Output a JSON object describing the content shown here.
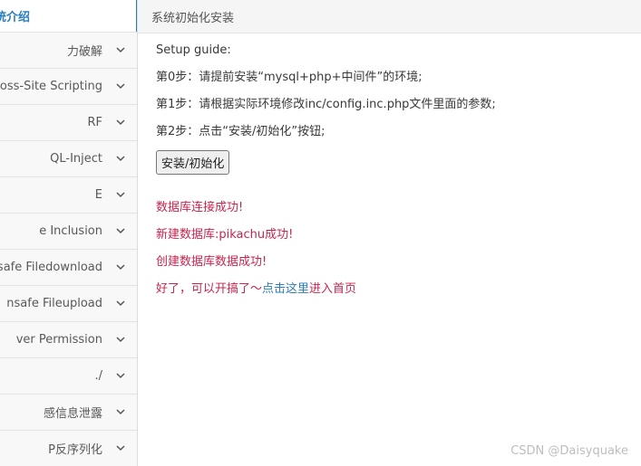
{
  "sidebar": {
    "items": [
      {
        "label": "统介绍",
        "active": true
      },
      {
        "label": "力破解"
      },
      {
        "label": "oss-Site Scripting"
      },
      {
        "label": "RF"
      },
      {
        "label": "QL-Inject"
      },
      {
        "label": "E"
      },
      {
        "label": "e Inclusion"
      },
      {
        "label": "nsafe Filedownload"
      },
      {
        "label": "nsafe Fileupload"
      },
      {
        "label": "ver Permission"
      },
      {
        "label": "./"
      },
      {
        "label": "感信息泄露"
      },
      {
        "label": "P反序列化"
      }
    ]
  },
  "topbar": {
    "title": "系统初始化安装"
  },
  "content": {
    "guide_title": "Setup guide:",
    "step0": "第0步：请提前安装“mysql+php+中间件”的环境;",
    "step1": "第1步：请根据实际环境修改inc/config.inc.php文件里面的参数;",
    "step2": "第2步：点击“安装/初始化”按钮;",
    "install_button": "安装/初始化",
    "msg_db_connect": "数据库连接成功!",
    "msg_db_create": "新建数据库:pikachu成功!",
    "msg_db_data": "创建数据库数据成功!",
    "msg_done_prefix": "好了，可以开搞了～",
    "msg_done_link": "点击这里",
    "msg_done_suffix": "进入首页"
  },
  "watermark": "CSDN @Daisyquake",
  "colors": {
    "accent": "#2b7dbc",
    "success": "#c7254e"
  }
}
